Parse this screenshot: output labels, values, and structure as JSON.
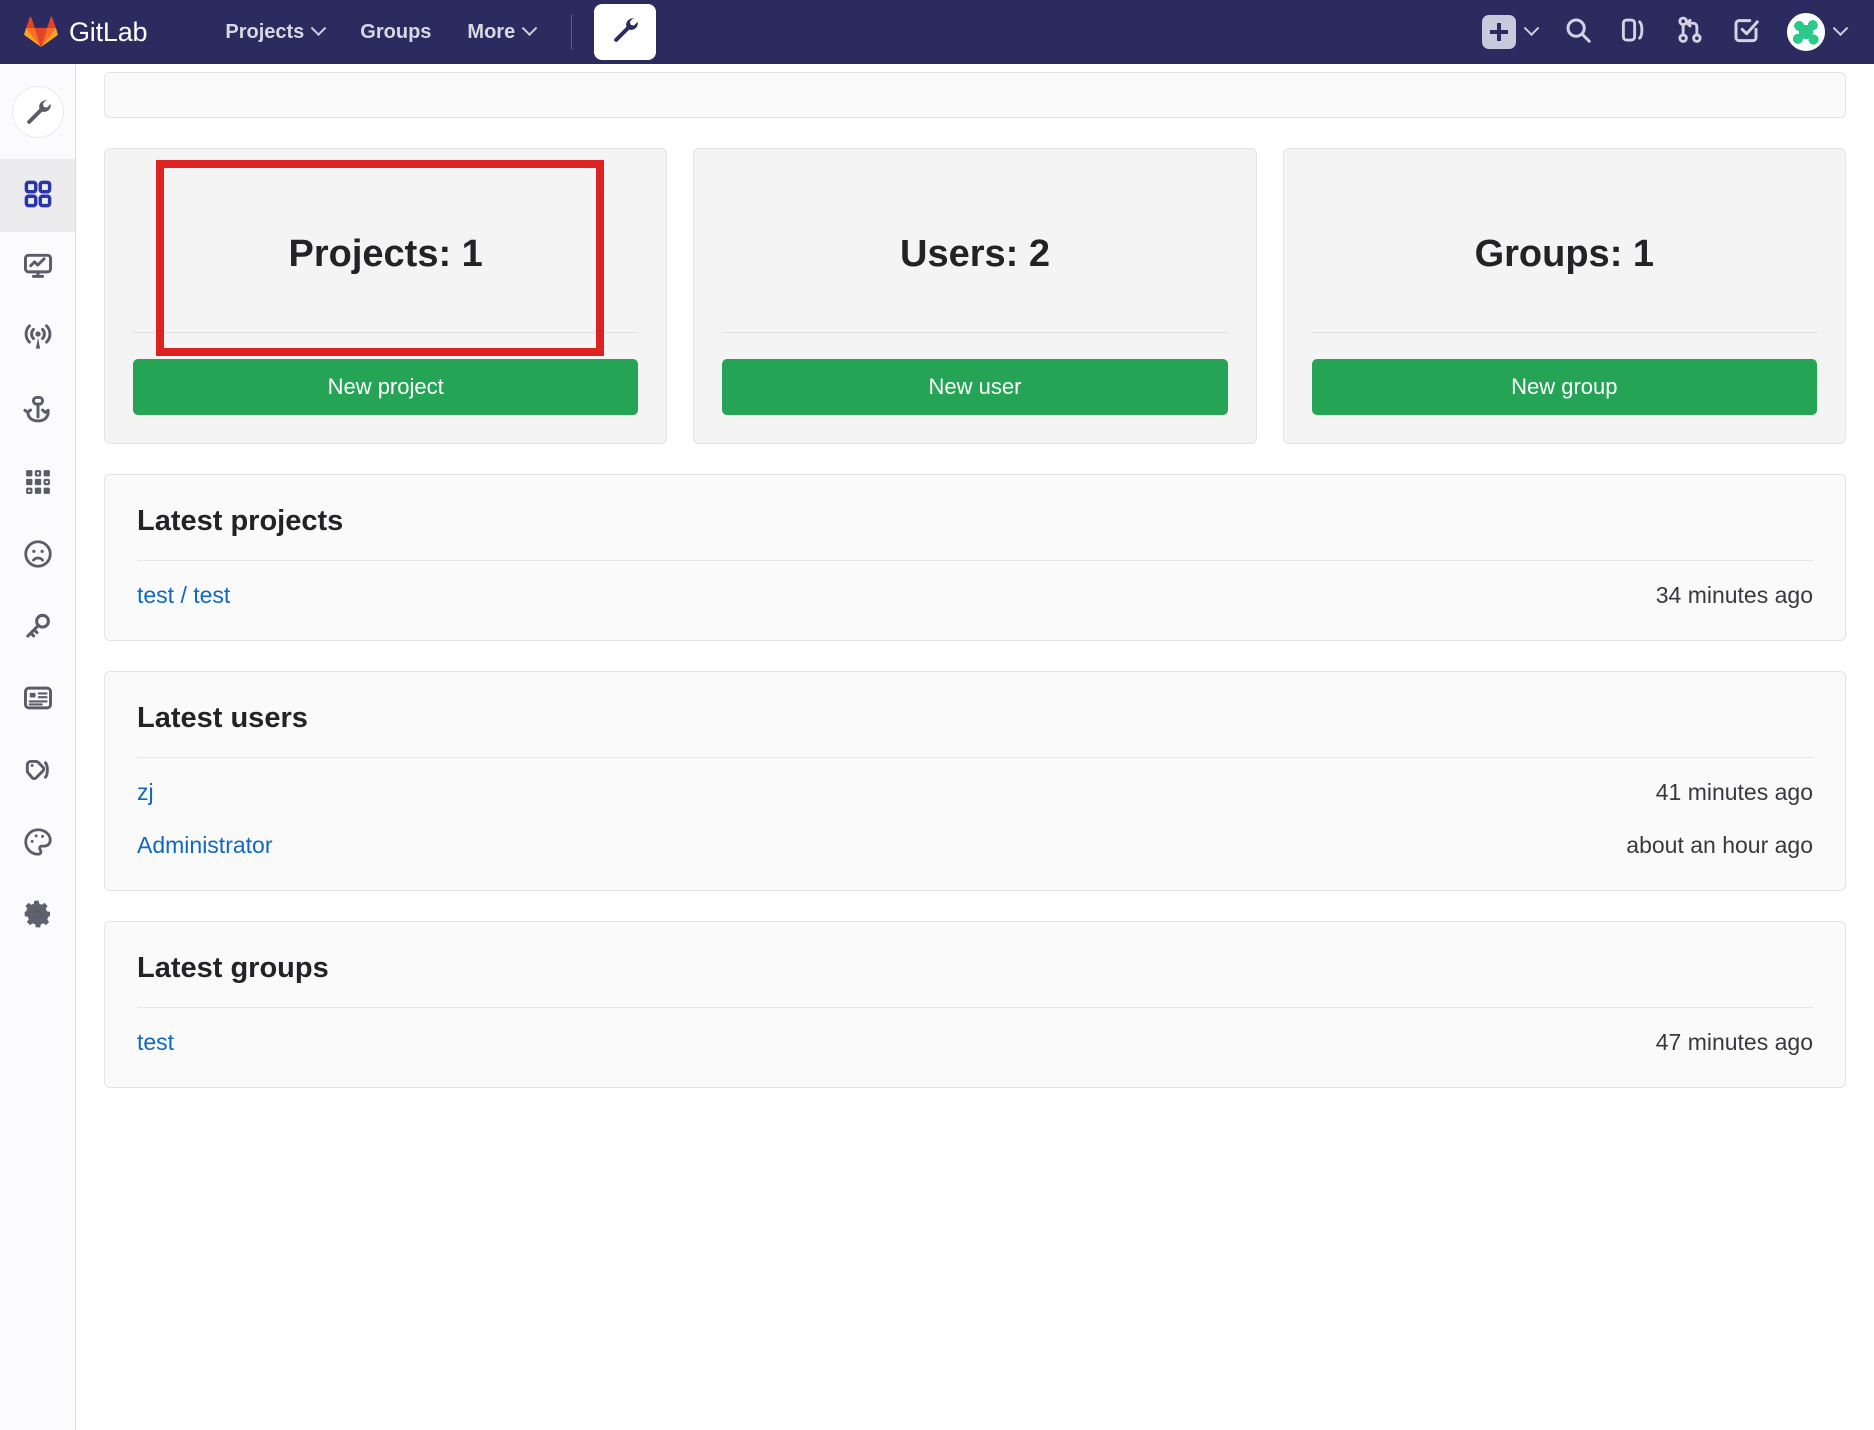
{
  "navbar": {
    "brand": "GitLab",
    "brand_logo_icon": "gitlab-tanuki-logo",
    "links": [
      {
        "label": "Projects",
        "has_caret": true
      },
      {
        "label": "Groups",
        "has_caret": false
      },
      {
        "label": "More",
        "has_caret": true
      }
    ],
    "admin_button_icon": "wrench-icon",
    "right_icons": [
      {
        "name": "plus-icon",
        "glyph": "+"
      },
      {
        "name": "search-icon",
        "glyph": "search"
      },
      {
        "name": "issues-icon",
        "glyph": "issues"
      },
      {
        "name": "merge-requests-icon",
        "glyph": "merge"
      },
      {
        "name": "todos-icon",
        "glyph": "todo"
      },
      {
        "name": "user-avatar",
        "glyph": "avatar"
      }
    ],
    "background_color": "#2b2b5f"
  },
  "sidebar": {
    "header_icon": "wrench-icon",
    "items": [
      {
        "name": "overview",
        "icon": "grid-squares-icon",
        "active": true
      },
      {
        "name": "monitoring",
        "icon": "monitor-chart-icon",
        "active": false
      },
      {
        "name": "messages",
        "icon": "broadcast-signal-icon",
        "active": false
      },
      {
        "name": "system-hooks",
        "icon": "anchor-icon",
        "active": false
      },
      {
        "name": "applications",
        "icon": "grid-dots-icon",
        "active": false
      },
      {
        "name": "abuse-reports",
        "icon": "sad-face-icon",
        "active": false
      },
      {
        "name": "deploy-keys",
        "icon": "key-icon",
        "active": false
      },
      {
        "name": "license",
        "icon": "id-card-icon",
        "active": false
      },
      {
        "name": "labels",
        "icon": "label-tag-icon",
        "active": false
      },
      {
        "name": "appearance",
        "icon": "palette-icon",
        "active": false
      },
      {
        "name": "settings",
        "icon": "gear-icon",
        "active": false
      }
    ]
  },
  "stat_cards": [
    {
      "title": "Projects: 1",
      "button": "New project",
      "highlighted": true
    },
    {
      "title": "Users: 2",
      "button": "New user",
      "highlighted": false
    },
    {
      "title": "Groups: 1",
      "button": "New group",
      "highlighted": false
    }
  ],
  "sections": [
    {
      "title": "Latest projects",
      "rows": [
        {
          "link": "test / test",
          "time": "34 minutes ago"
        }
      ]
    },
    {
      "title": "Latest users",
      "rows": [
        {
          "link": "zj",
          "time": "41 minutes ago"
        },
        {
          "link": "Administrator",
          "time": "about an hour ago"
        }
      ]
    },
    {
      "title": "Latest groups",
      "rows": [
        {
          "link": "test",
          "time": "47 minutes ago"
        }
      ]
    }
  ],
  "annotation": {
    "name": "red-highlight-box",
    "color": "#dd2222",
    "targets": "projects-stat-card"
  },
  "colors": {
    "navbar": "#2b2b5f",
    "primary_button": "#25a455",
    "link": "#1068bf",
    "highlight": "#dd2222"
  }
}
